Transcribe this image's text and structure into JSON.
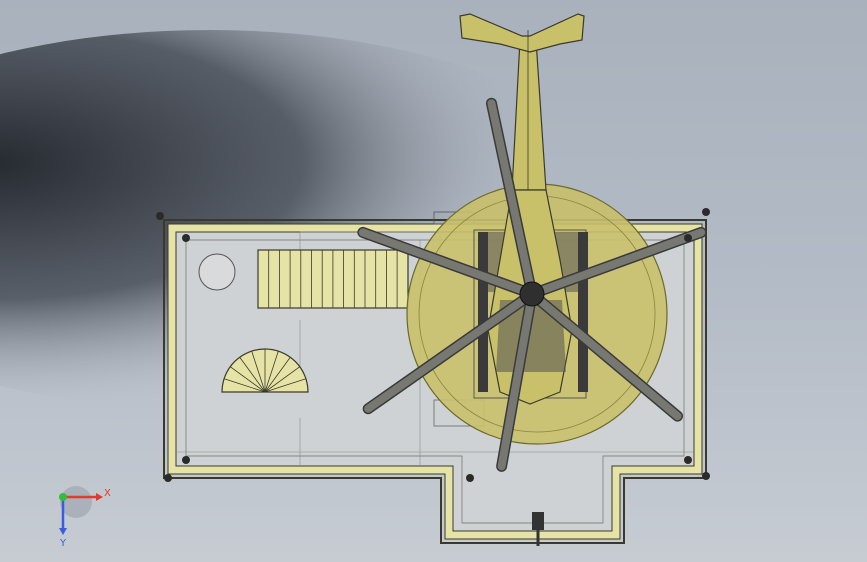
{
  "app": {
    "title": "",
    "view": "top"
  },
  "triad": {
    "x_label": "X",
    "y_label": "Y",
    "x_color": "#e23a2c",
    "y_color": "#3a5be2",
    "origin_color": "#2fbf3a"
  },
  "colors": {
    "background": "#b3bbc6",
    "shadow": "#2a2e36",
    "frame_edge": "#3a3a2a",
    "frame_fill": "#e6e3a6",
    "deck_fill": "#cfd2d4",
    "helipad_fill": "#c9c06a",
    "helipad_edge": "#6b6a2a",
    "blade_fill": "#7c7e76",
    "fuselage_fill": "#c9c06a",
    "stair_fill": "#e6e3a6"
  },
  "scene": {
    "objects": [
      "platform-frame",
      "staircase-straight",
      "staircase-spiral",
      "helipad",
      "helicopter",
      "tail-boom",
      "main-rotor",
      "landing-lights",
      "access-walkway"
    ]
  }
}
